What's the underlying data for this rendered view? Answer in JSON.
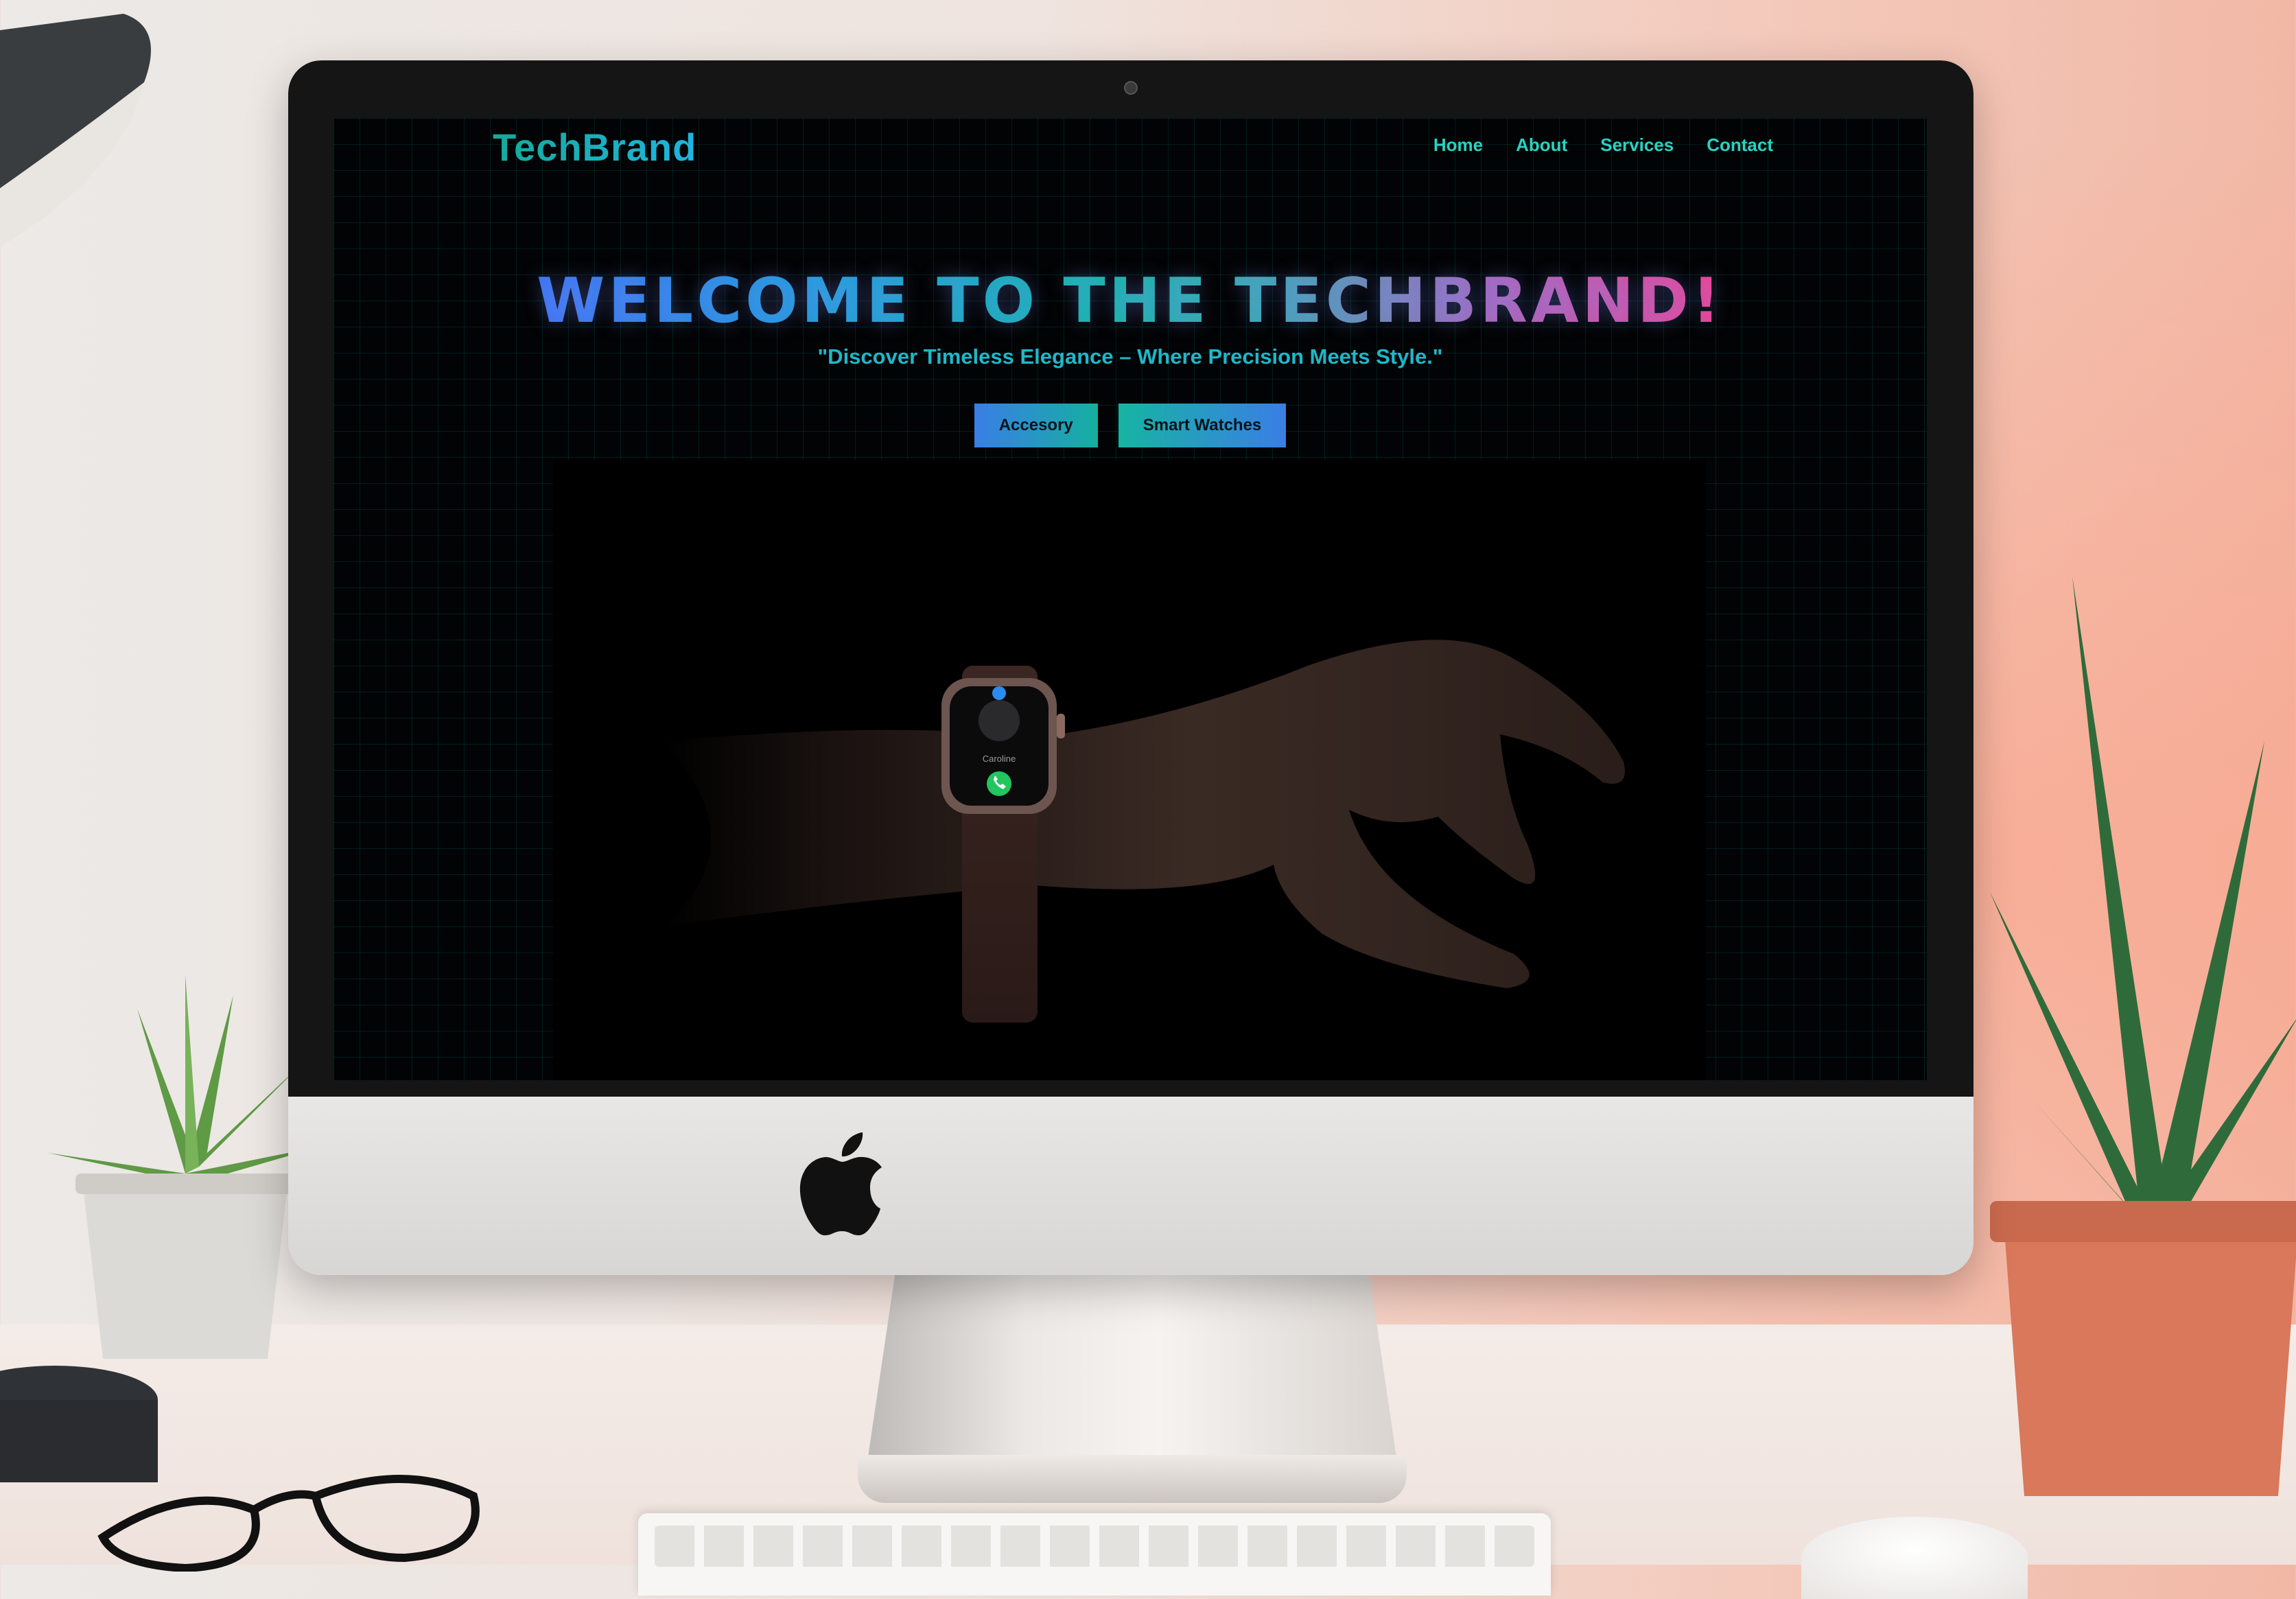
{
  "site": {
    "brand": "TechBrand",
    "nav": [
      "Home",
      "About",
      "Services",
      "Contact"
    ]
  },
  "hero": {
    "title": "WELCOME TO THE TECHBRAND!",
    "tagline": "\"Discover Timeless Elegance – Where Precision Meets Style.\"",
    "buttons": [
      "Accesory",
      "Smart Watches"
    ]
  },
  "watch_face": {
    "caller": "Caroline"
  },
  "colors": {
    "accent_teal": "#14b7a6",
    "accent_blue": "#3d73f0",
    "accent_pink": "#f04190",
    "screen_bg": "#020304"
  },
  "icons": [
    "apple-logo-icon",
    "phone-answer-icon"
  ]
}
